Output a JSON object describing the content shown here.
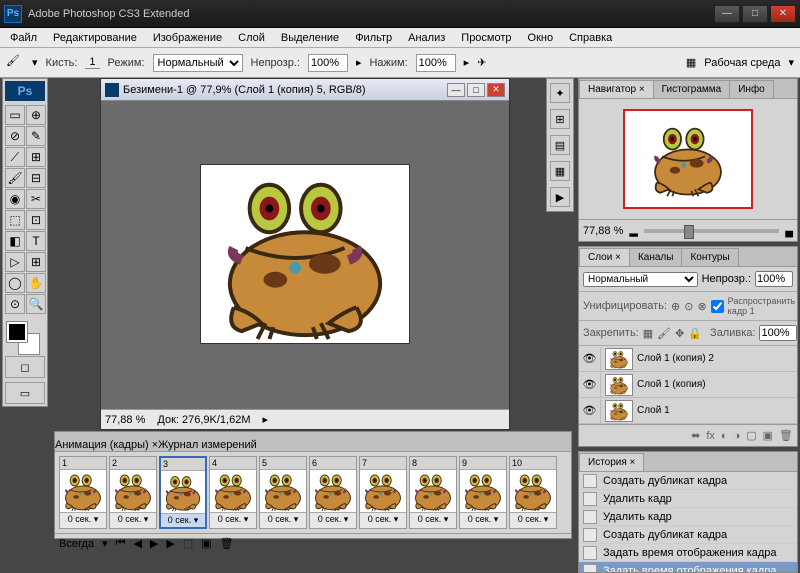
{
  "app_title": "Adobe Photoshop CS3 Extended",
  "menu": [
    "Файл",
    "Редактирование",
    "Изображение",
    "Слой",
    "Выделение",
    "Фильтр",
    "Анализ",
    "Просмотр",
    "Окно",
    "Справка"
  ],
  "options": {
    "brush_label": "Кисть:",
    "brush_val": "1",
    "mode_label": "Режим:",
    "mode_val": "Нормальный",
    "opacity_label": "Непрозр.:",
    "opacity_val": "100%",
    "flow_label": "Нажим:",
    "flow_val": "100%",
    "workspace_label": "Рабочая среда"
  },
  "doc": {
    "title": "Безимени-1 @ 77,9% (Слой 1 (копия) 5, RGB/8)",
    "zoom": "77,88 %",
    "docsize": "Док: 276,9K/1,62M"
  },
  "navigator": {
    "tabs": [
      "Навигатор ×",
      "Гистограмма",
      "Инфо"
    ],
    "zoom": "77,88 %"
  },
  "layers_panel": {
    "tabs": [
      "Слои ×",
      "Каналы",
      "Контуры"
    ],
    "blend": "Нормальный",
    "opacity_label": "Непрозр.:",
    "opacity_val": "100%",
    "unify_label": "Унифицировать:",
    "propagate": "Распространить кадр 1",
    "lock_label": "Закрепить:",
    "fill_label": "Заливка:",
    "fill_val": "100%",
    "layers": [
      {
        "name": "Слой 1 (копия) 2"
      },
      {
        "name": "Слой 1 (копия)"
      },
      {
        "name": "Слой 1"
      }
    ]
  },
  "history": {
    "tab": "История ×",
    "items": [
      {
        "t": "Создать дубликат кадра"
      },
      {
        "t": "Удалить кадр"
      },
      {
        "t": "Удалить кадр"
      },
      {
        "t": "Создать дубликат кадра"
      },
      {
        "t": "Задать время отображения кадра"
      },
      {
        "t": "Задать время отображения кадра",
        "sel": true
      }
    ]
  },
  "animation": {
    "tabs": [
      "Анимация (кадры) ×",
      "Журнал измерений"
    ],
    "frames": [
      {
        "n": "1",
        "t": "0 сек."
      },
      {
        "n": "2",
        "t": "0 сек."
      },
      {
        "n": "3",
        "t": "0 сек.",
        "sel": true
      },
      {
        "n": "4",
        "t": "0 сек."
      },
      {
        "n": "5",
        "t": "0 сек."
      },
      {
        "n": "6",
        "t": "0 сек."
      },
      {
        "n": "7",
        "t": "0 сек."
      },
      {
        "n": "8",
        "t": "0 сек."
      },
      {
        "n": "9",
        "t": "0 сек."
      },
      {
        "n": "10",
        "t": "0 сек."
      }
    ],
    "loop": "Всегда"
  }
}
